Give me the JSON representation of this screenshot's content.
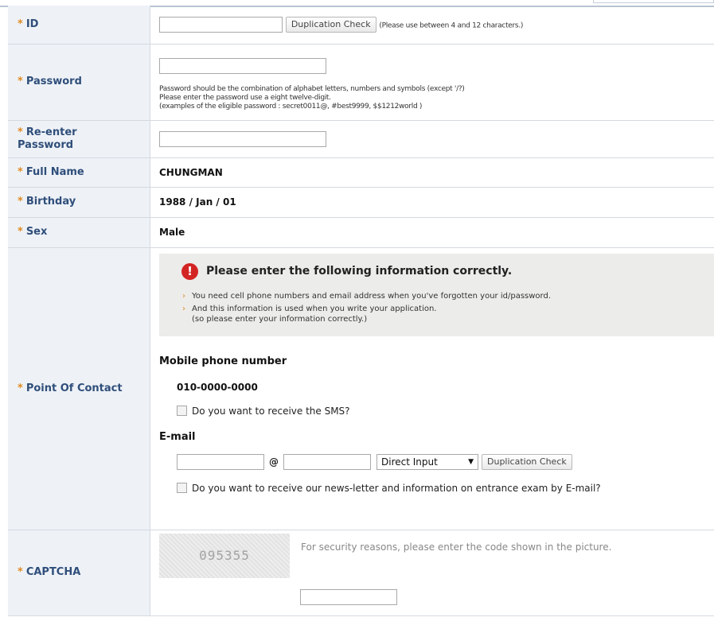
{
  "form": {
    "id": {
      "label": "ID",
      "button": "Duplication Check",
      "hint": "(Please use between 4 and 12 characters.)"
    },
    "password": {
      "label": "Password",
      "hint_lines": [
        "Password should be the combination of alphabet letters, numbers and symbols (except '/?)",
        "Please enter the password use a eight twelve-digit.",
        "(examples of the eligible password : secret0011@, #best9999, $$1212world )"
      ]
    },
    "reenter": {
      "label_line1": "Re-enter",
      "label_line2": "Password"
    },
    "fullname": {
      "label": "Full Name",
      "value": "CHUNGMAN"
    },
    "birthday": {
      "label": "Birthday",
      "value": "1988 / Jan / 01"
    },
    "sex": {
      "label": "Sex",
      "value": "Male"
    },
    "contact": {
      "label": "Point Of Contact",
      "notice_title": "Please enter the following information correctly.",
      "notice_icon": "!",
      "notice_items": [
        "You need cell phone numbers and email address when you've forgotten your id/password.",
        "And this information is used when you write your application.",
        "(so please enter your information correctly.)"
      ],
      "mobile_heading": "Mobile phone number",
      "mobile_value": "010-0000-0000",
      "sms_label": "Do you want to receive the SMS?",
      "email_heading": "E-mail",
      "at": "@",
      "domain_select": "Direct Input",
      "email_button": "Duplication Check",
      "newsletter_label": "Do you want to receive our news-letter and information on entrance exam by E-mail?"
    },
    "captcha": {
      "label": "CAPTCHA",
      "image_text": "095355",
      "instruction": "For security reasons, please enter the code shown in the picture."
    }
  },
  "colors": {
    "label_text": "#2f4e7a",
    "star": "#e08b24",
    "notice_icon": "#d32424",
    "label_bg": "#eef2f7"
  },
  "icons": {
    "required": "asterisk-icon",
    "notice": "exclamation-icon",
    "select": "triangle-down-icon"
  }
}
